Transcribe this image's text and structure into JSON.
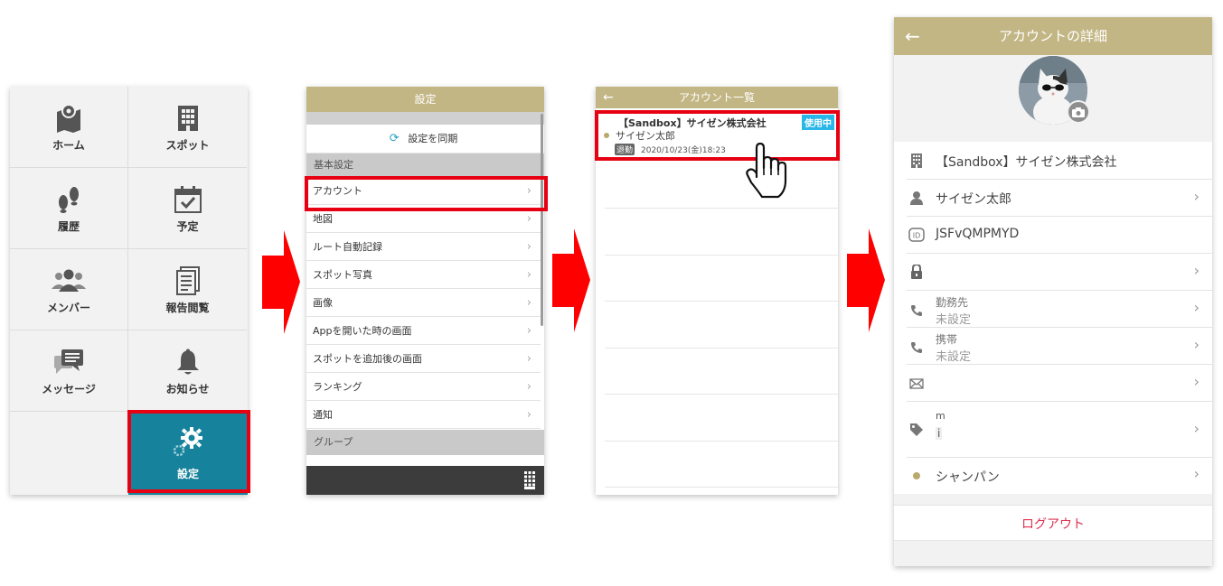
{
  "colors": {
    "accent_red": "#e60012",
    "header_gold": "#c3b685",
    "teal": "#16829b",
    "link_red": "#e03050",
    "badge_blue": "#29b6e8"
  },
  "menu": {
    "items": [
      {
        "label": "ホーム",
        "icon": "map-pin-icon"
      },
      {
        "label": "スポット",
        "icon": "building-icon"
      },
      {
        "label": "履歴",
        "icon": "footprints-icon"
      },
      {
        "label": "予定",
        "icon": "calendar-check-icon"
      },
      {
        "label": "メンバー",
        "icon": "people-icon"
      },
      {
        "label": "報告閲覧",
        "icon": "document-icon"
      },
      {
        "label": "メッセージ",
        "icon": "chat-icon"
      },
      {
        "label": "お知らせ",
        "icon": "bell-icon"
      },
      {
        "label": "設定",
        "icon": "gear-icon"
      }
    ]
  },
  "settings": {
    "title": "設定",
    "sync_label": "設定を同期",
    "section_basic": "基本設定",
    "items": [
      "アカウント",
      "地図",
      "ルート自動記録",
      "スポット写真",
      "画像",
      "Appを開いた時の画面",
      "スポットを追加後の画面",
      "ランキング",
      "通知"
    ],
    "section_group": "グループ"
  },
  "account_list": {
    "title": "アカウント一覧",
    "account": {
      "company": "【Sandbox】サイゼン株式会社",
      "badge": "使用中",
      "user": "サイゼン太郎",
      "status": "退勤",
      "datetime": "2020/10/23(金)18:23"
    }
  },
  "account_detail": {
    "title": "アカウントの詳細",
    "company": "【Sandbox】サイゼン株式会社",
    "user": "サイゼン太郎",
    "id_value": "JSFvQMPMYD",
    "work_phone_label": "勤務先",
    "work_phone_value": "未設定",
    "mobile_label": "携帯",
    "mobile_value": "未設定",
    "tag_label": "m",
    "tag_value": "i",
    "status_label": "シャンパン",
    "logout": "ログアウト"
  }
}
